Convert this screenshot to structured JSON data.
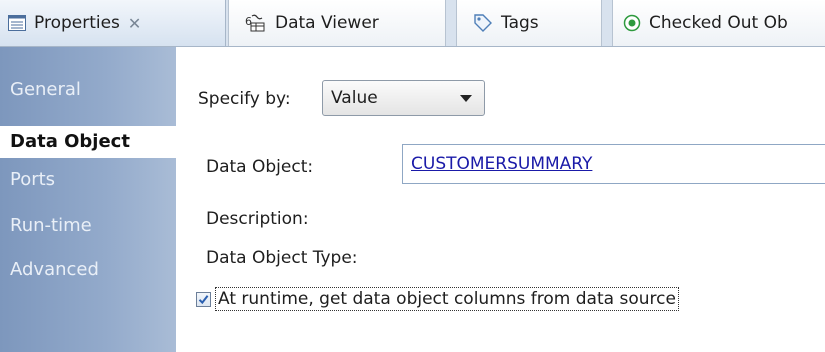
{
  "tabs": [
    {
      "label": "Properties",
      "active": true,
      "icon": "properties-icon",
      "close": "✕"
    },
    {
      "label": "Data Viewer",
      "active": false,
      "icon": "data-viewer-icon"
    },
    {
      "label": "Tags",
      "active": false,
      "icon": "tag-icon"
    },
    {
      "label": "Checked Out Ob",
      "active": false,
      "icon": "checked-out-icon"
    }
  ],
  "sidenav": {
    "items": [
      {
        "label": "General"
      },
      {
        "label": "Data Object",
        "selected": true
      },
      {
        "label": "Ports"
      },
      {
        "label": "Run-time"
      },
      {
        "label": "Advanced"
      }
    ]
  },
  "form": {
    "specify_by_label": "Specify by:",
    "specify_by_value": "Value",
    "data_object_label": "Data Object:",
    "data_object_value": "CUSTOMERSUMMARY",
    "description_label": "Description:",
    "data_object_type_label": "Data Object Type:",
    "runtime_checkbox_label": "At runtime, get data object columns from data source",
    "runtime_checkbox_checked": true
  },
  "colors": {
    "nav_gradient_start": "#7d97bd",
    "nav_gradient_end": "#a9bcd6",
    "link": "#1a1aa8",
    "check": "#2a5fb0"
  }
}
